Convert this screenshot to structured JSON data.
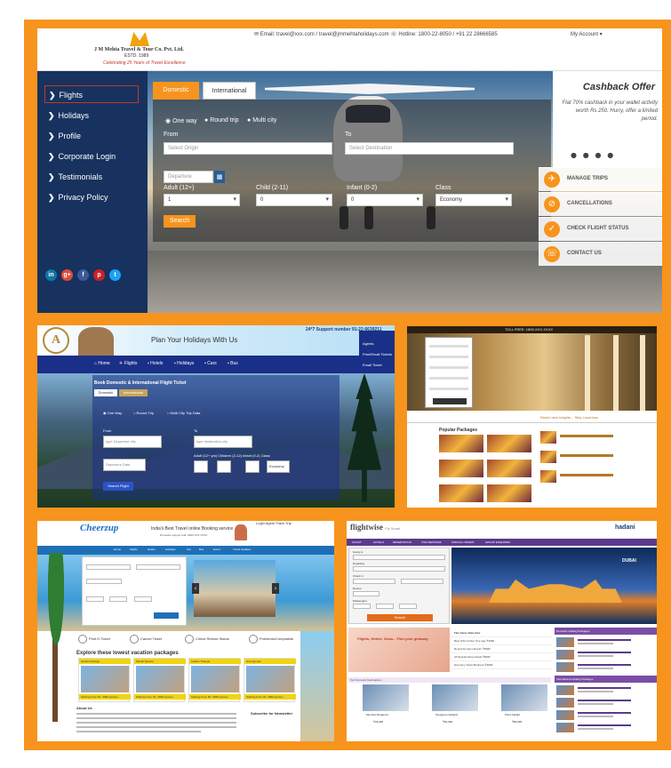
{
  "main": {
    "logo_name": "J M Mehta Travel & Tour Co. Pvt. Ltd.",
    "logo_est": "ESTD. 1989",
    "logo_tag": "Celebrating 25 Years of Travel Excellence",
    "contact": "✉ Email: travel@xxx.com / travel@jmmehtaholidays.com  ☏ Hotline: 1800-22-8050 / +91 22 28666585",
    "my_account": "My Account ▾",
    "sidebar": [
      {
        "label": "Flights"
      },
      {
        "label": "Holidays"
      },
      {
        "label": "Profile"
      },
      {
        "label": "Corporate Login"
      },
      {
        "label": "Testimonials"
      },
      {
        "label": "Privacy Policy"
      }
    ],
    "socials": [
      "in",
      "g+",
      "f",
      "p",
      "t"
    ],
    "social_colors": [
      "#0e76a8",
      "#dd4b39",
      "#3b5998",
      "#cb2027",
      "#1da1f2"
    ],
    "tabs": {
      "domestic": "Domestic",
      "international": "International"
    },
    "trip_types": [
      "One way",
      "Round trip",
      "Multi city"
    ],
    "from_label": "From",
    "to_label": "To",
    "origin_placeholder": "Select Origin",
    "dest_placeholder": "Select Destination",
    "departure_placeholder": "Departure",
    "adult_label": "Adult (12+)",
    "child_label": "Child (2-11)",
    "infant_label": "Infant (0-2)",
    "class_label": "Class",
    "adult_value": "1",
    "child_value": "0",
    "infant_value": "0",
    "class_value": "Economy",
    "search": "Search",
    "cashback_title": "Cashback Offer",
    "cashback_text": "Flat 70% cashback in your wallet activity worth Rs 250. Hurry, offer a limited period.",
    "cashback_dots": "● ● ● ●",
    "actions": [
      "MANAGE TRIPS",
      "CANCELLATIONS",
      "CHECK FLIGHT STATUS",
      "CONTACT US"
    ],
    "accent": "#f7941d",
    "navy": "#17325e"
  },
  "p2": {
    "logo": "A",
    "title": "Plan Your Holidays With Us",
    "phone": "24*7 Support number\n91-22-6639211",
    "nav": [
      "Home",
      "Flights",
      "Hotels",
      "Holidays",
      "Cars",
      "Bus"
    ],
    "side": [
      "Agents",
      "Print/Email Tickets",
      "Email Ticket"
    ],
    "form_title": "Book Domestic & International Flight Ticket",
    "tab_dom": "Domestic",
    "tab_int": "International",
    "radios": [
      "One Way",
      "Round Trip",
      "Multi City Trip Data"
    ],
    "from": "From",
    "to": "To",
    "origin": "type Departure city",
    "dest": "type destination city",
    "date": "Departure Date",
    "pax": "Adult (12+ yrs)  Children (2-12)  Infant (0-2)  Class",
    "class": "Economy",
    "btn": "Search Flight"
  },
  "p3": {
    "bar": "TOLL FREE: 1800-XXX-XXXX",
    "mid": "Reach new heights... Stay Luxurious",
    "popular": "Popular Packages"
  },
  "p4": {
    "logo": "Cheerzup",
    "tagline": "India's Best Travel online Booking service",
    "tagline2": "Domestic support Call: 1800 XXX XXXX",
    "login": "Login  Agent  Track Trip",
    "nav": [
      "Home",
      "Flights",
      "Hotels",
      "Holidays",
      "Car",
      "Bus",
      "Event",
      "Travel Updates"
    ],
    "features": [
      "Print E-Ticket",
      "Cancel Ticket",
      "Check Refund Status",
      "Problems/Complaints"
    ],
    "explore": "Explore these lowest vacation packages",
    "cards": [
      "Kerala Package",
      "Manali Special",
      "Golden Triangle",
      "Goa Special"
    ],
    "price": "Starting From Rs. 9999 /person",
    "about": "About Us",
    "newsletter": "Subscribe for Newsletter"
  },
  "p5": {
    "logo": "flightwise",
    "logo_small": "Fly Smart",
    "brand": "hadani",
    "nav": [
      "FLIGHT",
      "HOTELS",
      "RESERVATION",
      "VISA SERVICES",
      "SPECIAL OFFERS",
      "GROUP ENQUIRIES"
    ],
    "labels": [
      "Going to",
      "Departing",
      "Check in",
      "Rooms",
      "Passengers"
    ],
    "search": "Search",
    "dubai": "DUBAI",
    "banner": "Flights, Hotels, Visas... Plan your getaway",
    "table": [
      "Flex Fares          Date          Fare",
      "Best Price Finder   One way       ₹3999",
      "Round trip fares    Return        ₹5999",
      "All Special Fares   Deals         ₹6999",
      "Economy Class       Business      ₹9999"
    ],
    "sec1": "Domestic Holiday Packages",
    "sec2": "International Holiday Packages",
    "bottom": "Top Domestic Destinations",
    "pkgs": [
      "Mumbai-Singapore",
      "Singapore Delights",
      "Paris Delight"
    ],
    "prices": [
      "₹49,999",
      "₹62,999",
      "₹89,999"
    ]
  }
}
